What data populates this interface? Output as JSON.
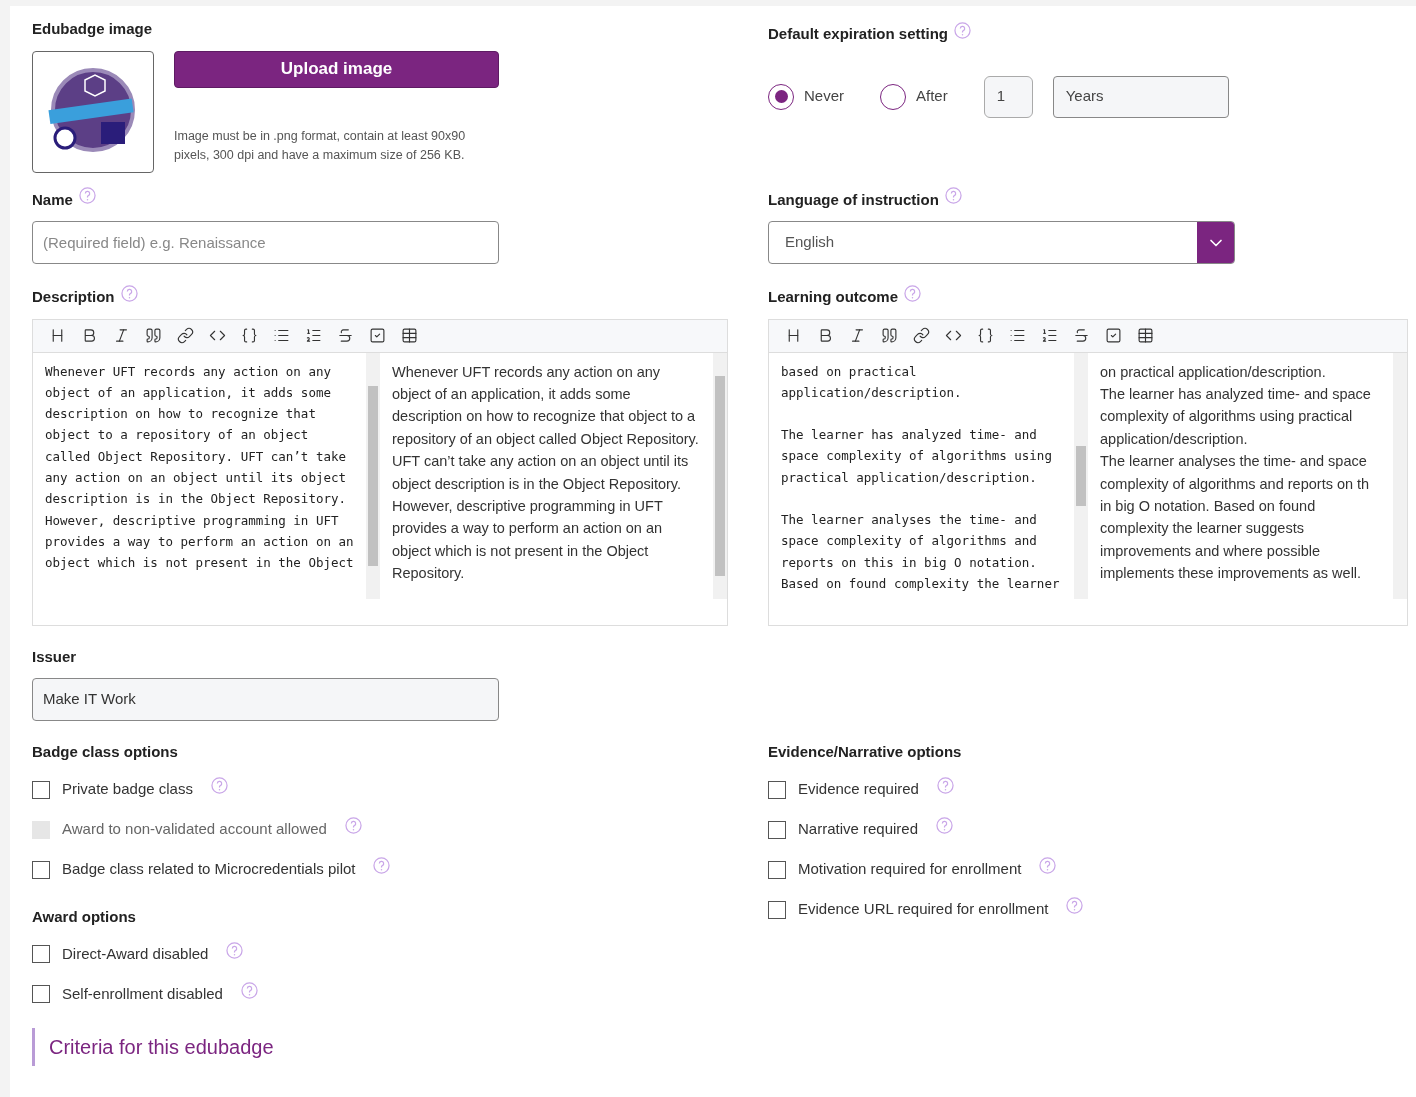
{
  "badge_image": {
    "label": "Edubadge image",
    "upload_button": "Upload image",
    "hint": "Image must be in .png format, contain at least 90x90 pixels, 300 dpi and have a maximum size of 256 KB."
  },
  "expiration": {
    "label": "Default expiration setting",
    "options": [
      {
        "label": "Never",
        "selected": true
      },
      {
        "label": "After",
        "selected": false
      }
    ],
    "amount": "1",
    "unit": "Years"
  },
  "name": {
    "label": "Name",
    "placeholder": "(Required field) e.g. Renaissance"
  },
  "language": {
    "label": "Language of instruction",
    "value": "English"
  },
  "description": {
    "label": "Description",
    "source": "Whenever UFT records any action on any object of an application, it adds some description on how to recognize that object to a repository of an object called Object Repository. UFT can’t take any action on an object until its object description is in the Object Repository. However, descriptive programming in UFT provides a way to perform an action on an object which is not present in the Object",
    "preview": [
      "Whenever UFT records any action on any object of an application, it adds some description on how to recognize that object to a repository of an object called Object Repository. UFT can’t take any action on an object until its object description is in the Object Repository. However, descriptive programming in UFT provides a way to perform an action on an object which is not present in the Object Repository."
    ]
  },
  "learning_outcome": {
    "label": "Learning outcome",
    "source": [
      "based on practical application/description.",
      "The learner has analyzed time- and space complexity of algorithms using practical application/description.",
      "The learner analyses the time- and space complexity of algorithms and reports on this in big O notation. Based on found complexity the learner"
    ],
    "preview": [
      "on practical application/description.",
      "The learner has analyzed time- and space complexity of algorithms using practical application/description.",
      "The learner analyses the time- and space complexity of algorithms and reports on th",
      "in big O notation. Based on found complexity the learner suggests improvements and where possible implements these improvements as well."
    ]
  },
  "issuer": {
    "label": "Issuer",
    "value": "Make IT Work"
  },
  "badge_class_options": {
    "label": "Badge class options",
    "items": [
      {
        "label": "Private badge class",
        "checked": false,
        "disabled": false
      },
      {
        "label": "Award to non-validated account allowed",
        "checked": false,
        "disabled": true
      },
      {
        "label": "Badge class related to Microcredentials pilot",
        "checked": false,
        "disabled": false
      }
    ]
  },
  "evidence_options": {
    "label": "Evidence/Narrative options",
    "items": [
      {
        "label": "Evidence required",
        "checked": false,
        "disabled": false
      },
      {
        "label": "Narrative required",
        "checked": false,
        "disabled": false
      },
      {
        "label": "Motivation required for enrollment",
        "checked": false,
        "disabled": false
      },
      {
        "label": "Evidence URL required for enrollment",
        "checked": false,
        "disabled": false
      }
    ]
  },
  "award_options": {
    "label": "Award options",
    "items": [
      {
        "label": "Direct-Award disabled",
        "checked": false,
        "disabled": false
      },
      {
        "label": "Self-enrollment disabled",
        "checked": false,
        "disabled": false
      }
    ]
  },
  "criteria": {
    "title": "Criteria for this edubadge"
  }
}
